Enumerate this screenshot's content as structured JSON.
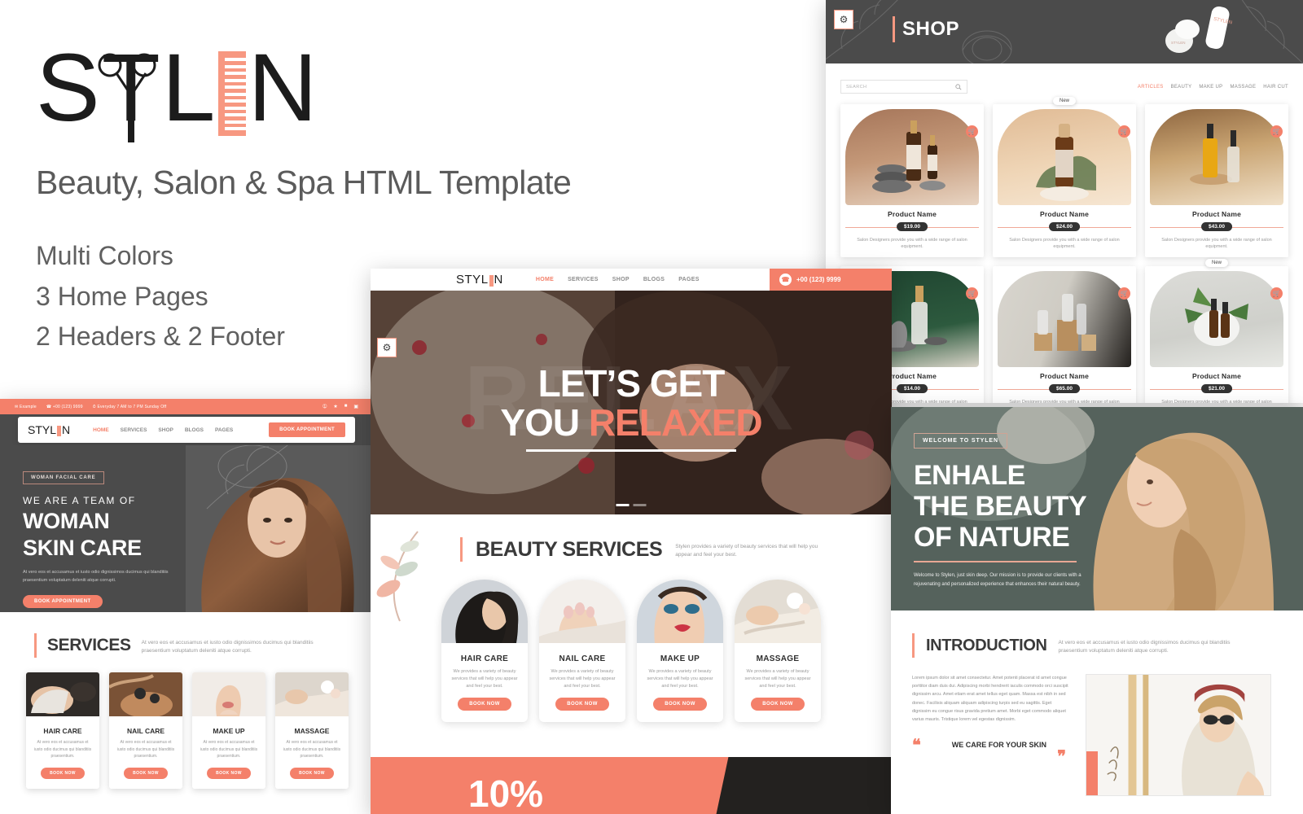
{
  "promo": {
    "logo_text_1": "ST",
    "logo_text_2": "L",
    "logo_text_3": "N",
    "brand": "STYLEN",
    "tagline": "Beauty, Salon & Spa HTML Template",
    "features": [
      "Multi Colors",
      "3 Home Pages",
      "2 Headers & 2 Footer"
    ]
  },
  "shop": {
    "hero_title": "SHOP",
    "gear_icon": "gear-icon",
    "search_placeholder": "SEARCH",
    "search_icon": "search-icon",
    "categories": [
      {
        "label": "ARTICLES",
        "active": true
      },
      {
        "label": "BEAUTY",
        "active": false
      },
      {
        "label": "MAKE UP",
        "active": false
      },
      {
        "label": "MASSAGE",
        "active": false
      },
      {
        "label": "HAIR CUT",
        "active": false
      }
    ],
    "product_desc": "Salon Designers provide you with a wide range of salon equipment.",
    "cart_icon": "cart-icon",
    "new_label": "New",
    "products": [
      {
        "name": "Product Name",
        "price": "$19.00",
        "new": false
      },
      {
        "name": "Product Name",
        "price": "$24.00",
        "new": true
      },
      {
        "name": "Product Name",
        "price": "$43.00",
        "new": false
      },
      {
        "name": "Product Name",
        "price": "$14.00",
        "new": false
      },
      {
        "name": "Product Name",
        "price": "$65.00",
        "new": false
      },
      {
        "name": "Product Name",
        "price": "$21.00",
        "new": true
      }
    ]
  },
  "center": {
    "menu": [
      {
        "label": "HOME",
        "caret": true,
        "active": true
      },
      {
        "label": "SERVICES",
        "caret": true,
        "active": false
      },
      {
        "label": "SHOP",
        "caret": false,
        "active": false
      },
      {
        "label": "BLOGS",
        "caret": true,
        "active": false
      },
      {
        "label": "PAGES",
        "caret": true,
        "active": false
      }
    ],
    "phone": "+00 (123) 9999",
    "phone_icon": "phone-icon",
    "hero_ghost": "RELAX",
    "hero_line1": "LET’S GET",
    "hero_line2_plain": "YOU ",
    "hero_line2_accent": "RELAXED",
    "section_title": "BEAUTY SERVICES",
    "section_sub": "Stylen provides a variety of beauty services that will help you appear and feel your best.",
    "service_desc": "We provides a variety of beauty services that will help you appear and feel your best.",
    "book_label": "BOOK NOW",
    "services": [
      {
        "name": "HAIR CARE"
      },
      {
        "name": "NAIL CARE"
      },
      {
        "name": "MAKE UP"
      },
      {
        "name": "MASSAGE"
      }
    ],
    "promo_percent": "10%"
  },
  "left": {
    "topbar": {
      "email": "Example",
      "email_icon": "mail-icon",
      "phone": "+00 (123) 9999",
      "phone_icon": "phone-icon",
      "hours": "Everyday 7 AM to 7 PM Sunday Off",
      "clock_icon": "clock-icon",
      "socials": [
        "facebook-icon",
        "twitter-icon",
        "linkedin-icon",
        "instagram-icon"
      ]
    },
    "menu": [
      {
        "label": "HOME",
        "caret": true,
        "active": true
      },
      {
        "label": "SERVICES",
        "caret": true,
        "active": false
      },
      {
        "label": "SHOP",
        "caret": false,
        "active": false
      },
      {
        "label": "BLOGS",
        "caret": true,
        "active": false
      },
      {
        "label": "PAGES",
        "caret": true,
        "active": false
      }
    ],
    "book_label": "BOOK APPOINTMENT",
    "hero_badge": "WOMAN FACIAL CARE",
    "hero_kicker": "WE ARE A TEAM OF",
    "hero_title_1": "WOMAN",
    "hero_title_2": "SKIN CARE",
    "hero_lead": "At vero eos et accusamus et iusto odio dignissimos ducimus qui blanditiis praesentium voluptatum deleniti atque corrupti.",
    "hero_button": "BOOK APPOINTMENT",
    "section_title": "SERVICES",
    "section_sub": "At vero eos et accusamus et iusto odio dignissimos ducimus qui blanditiis praesentium voluptatum deleniti atque corrupti.",
    "service_desc": "At vero eos et accusamus et iusto odio ducimus qui blanditiis praesentium.",
    "book_now": "BOOK NOW",
    "services": [
      {
        "name": "HAIR CARE"
      },
      {
        "name": "NAIL CARE"
      },
      {
        "name": "MAKE UP"
      },
      {
        "name": "MASSAGE"
      }
    ]
  },
  "right": {
    "badge": "WELCOME TO STYLEN",
    "title_1": "ENHALE",
    "title_2": "THE BEAUTY",
    "title_3": "OF NATURE",
    "lead": "Welcome to Stylen, just skin deep. Our mission is to provide our clients with a rejuvenating and personalized experience that enhances their natural beauty.",
    "section_title": "INTRODUCTION",
    "section_sub": "At vero eos et accusamus et iusto odio dignissimos ducimus qui blanditiis praesentium voluptatum deleniti atque corrupti.",
    "paragraph": "Lorem ipsum dolor sit amet consectetur. Amet potenti placerat id amet congue porttitor diam duis dui. Adipiscing morbi hendrerit iaculis commodo orci suscipit dignissim arcu. Amet etiam erat amet tellus eget quam. Massa est nibh in sed donec. Facilisis aliquam aliquam adipiscing turpis sed eu sagittis. Eget dignissim eu congue risus gravida pretium amet. Morbi eget commodo aliquet varius mauris. Tristique lorem vel egestas dignissim.",
    "quote": "WE CARE FOR YOUR SKIN"
  },
  "colors": {
    "accent": "#f4806a",
    "accent_light": "#f79881",
    "dark": "#4b4b4b",
    "text": "#2e2e2e",
    "muted": "#9a9a9a"
  }
}
